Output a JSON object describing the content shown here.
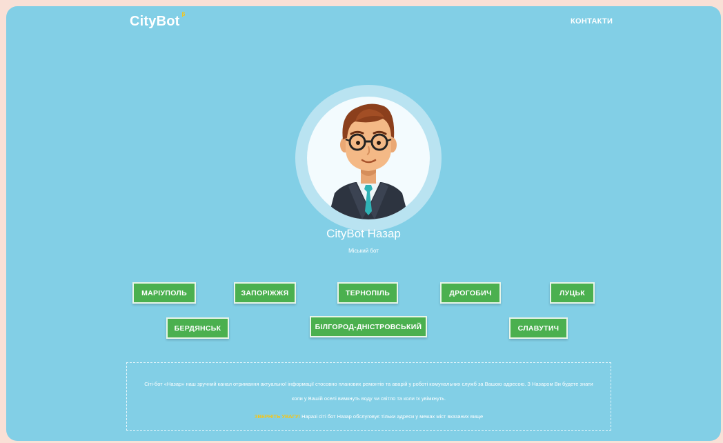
{
  "header": {
    "logo_text": "CityBot",
    "logo_badge": "β",
    "nav_contacts": "КОНТАКТИ"
  },
  "profile": {
    "name": "CityBot Назар",
    "subtitle": "Міський бот"
  },
  "cities": [
    {
      "label": "МАРІУПОЛЬ"
    },
    {
      "label": "ЗАПОРІЖЖЯ"
    },
    {
      "label": "ТЕРНОПІЛЬ"
    },
    {
      "label": "ДРОГОБИЧ"
    },
    {
      "label": "ЛУЦЬК"
    },
    {
      "label": "БЕРДЯНСЬК"
    },
    {
      "label": "БІЛГОРОД-ДНІСТРОВСЬКИЙ"
    },
    {
      "label": "СЛАВУТИЧ"
    }
  ],
  "info": {
    "description": "Сіті-бот «Назар» наш зручний канал отримання актуальної інформації стосовно планових ремонтів та аварій у роботі комунальних служб за Вашою адресою. З Назаром Ви будете знати коли у Вашій оселі вимкнуть воду чи світло та коли їх увімкнуть.",
    "warning_label": "ЗВЕРНІТЬ УВАГУ!",
    "warning_text": "Наразі сіті бот Назар обслуговує тільки адреси у межах міст вказаних вище"
  },
  "colors": {
    "background": "#82cfe6",
    "button": "#4bb04f",
    "accent": "#f5c518"
  }
}
